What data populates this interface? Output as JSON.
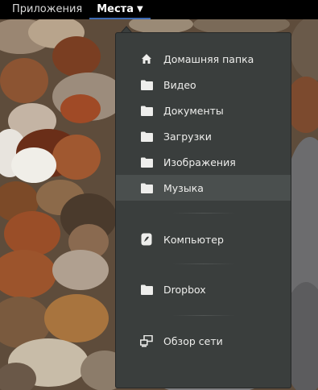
{
  "topbar": {
    "applications_label": "Приложения",
    "places_label": "Места",
    "places_arrow_icon": "triangle-down-icon"
  },
  "places_menu": {
    "items": [
      {
        "label": "Домашняя папка",
        "icon": "home-icon"
      },
      {
        "label": "Видео",
        "icon": "folder-icon"
      },
      {
        "label": "Документы",
        "icon": "folder-icon"
      },
      {
        "label": "Загрузки",
        "icon": "folder-icon"
      },
      {
        "label": "Изображения",
        "icon": "folder-icon"
      },
      {
        "label": "Музыка",
        "icon": "folder-icon",
        "hovered": true
      },
      {
        "label": "Компьютер",
        "icon": "drive-icon"
      },
      {
        "label": "Dropbox",
        "icon": "folder-icon"
      },
      {
        "label": "Обзор сети",
        "icon": "network-icon"
      }
    ]
  },
  "colors": {
    "topbar_bg": "#000000",
    "menu_bg": "#3a3e3d",
    "menu_hover_bg": "#4a4f4e",
    "text": "#eeeeec",
    "active_underline": "#3d6ab3"
  }
}
